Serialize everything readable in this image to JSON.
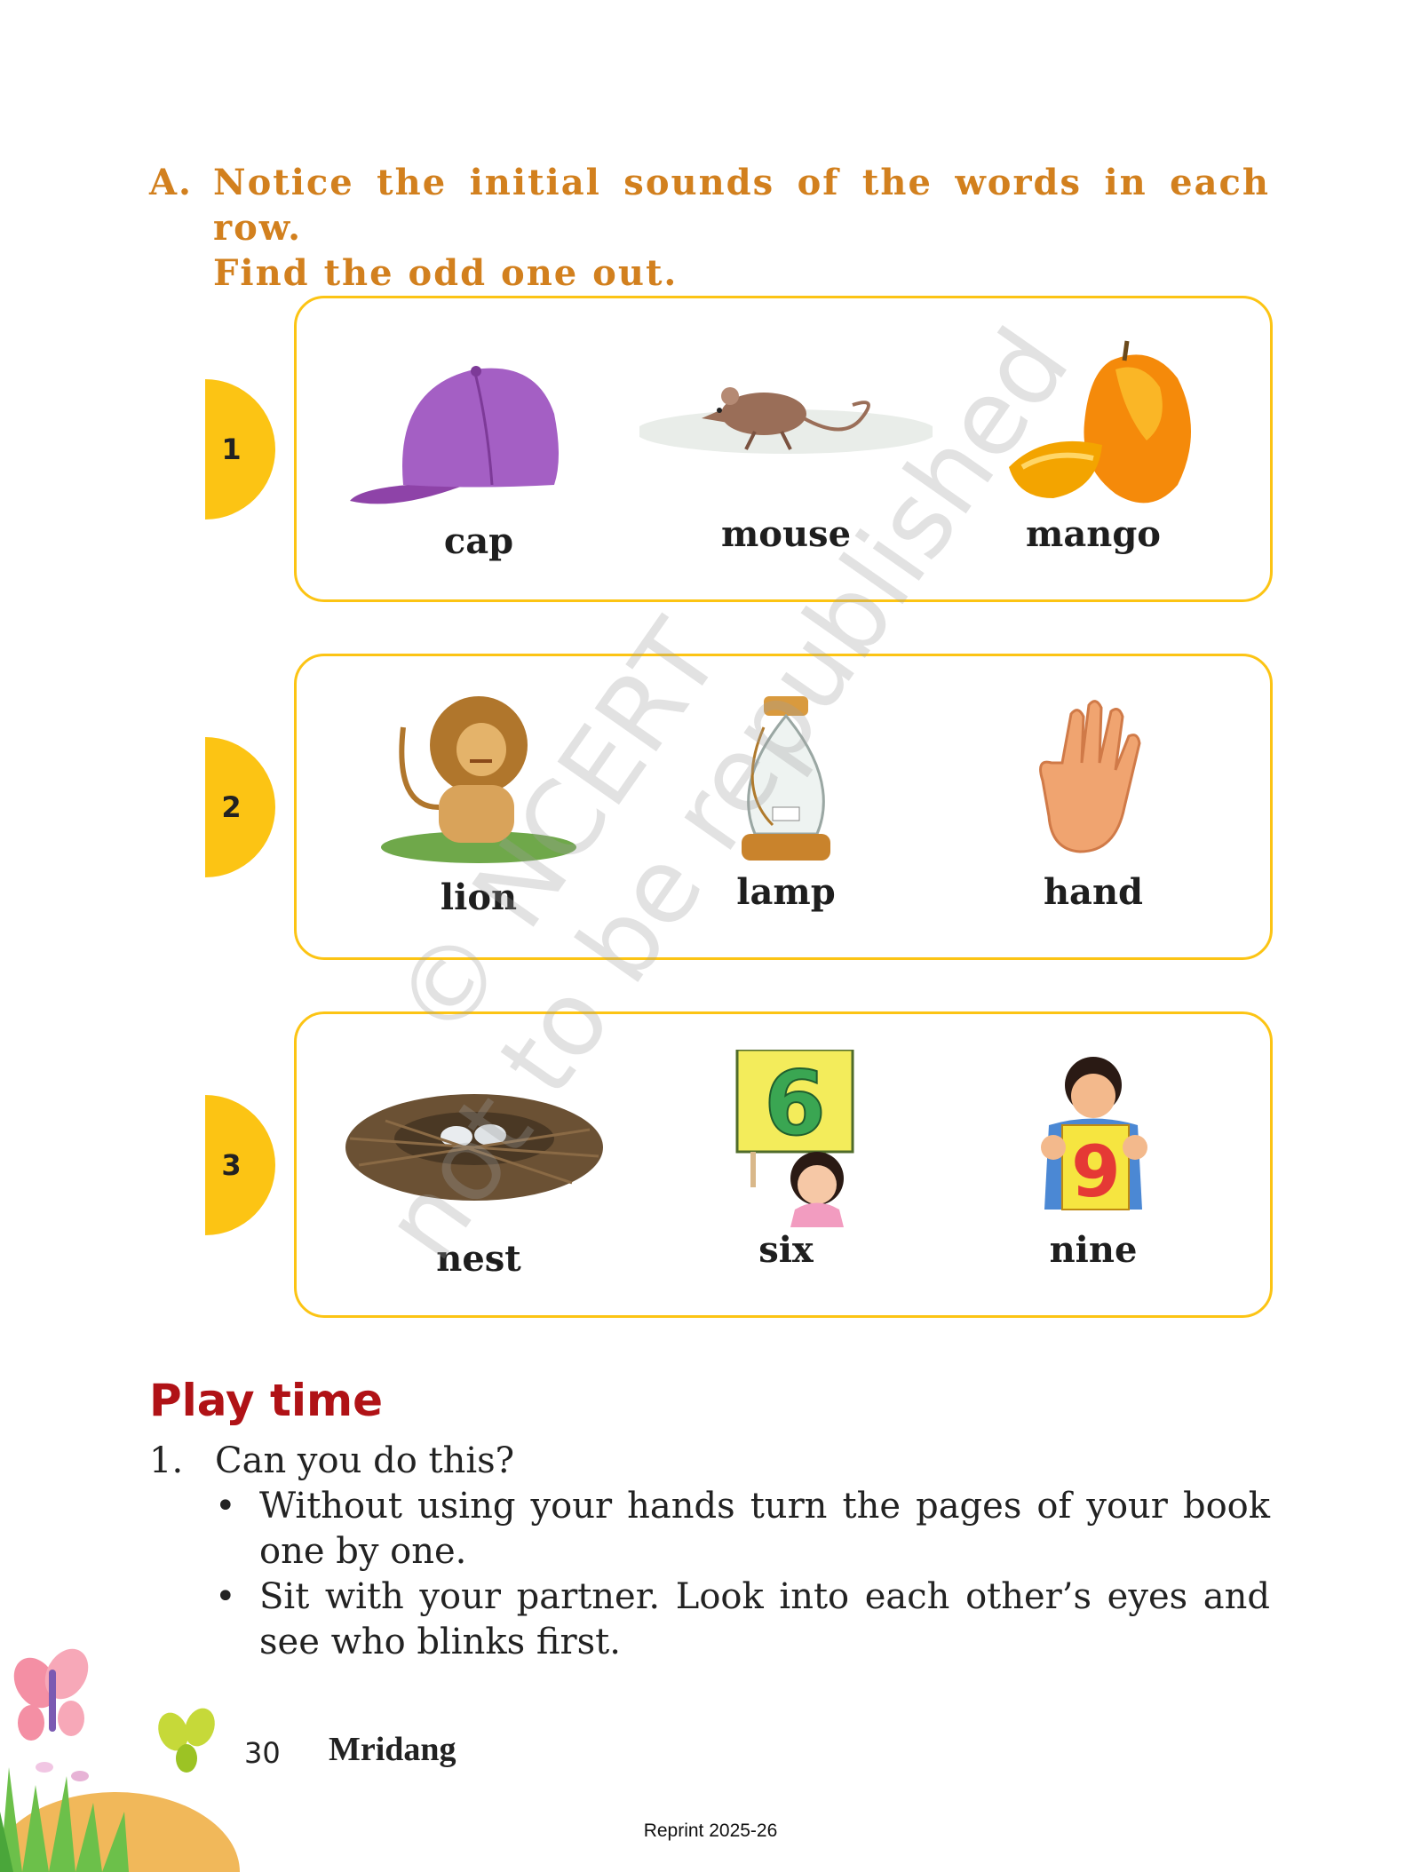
{
  "exercise": {
    "label": "A.",
    "line1": "Notice the initial sounds of the words in each row.",
    "line2": "Find the odd one out."
  },
  "rows": [
    {
      "number": "1",
      "words": [
        {
          "word": "cap",
          "picture": "purple-cap-icon"
        },
        {
          "word": "mouse",
          "picture": "mouse-icon"
        },
        {
          "word": "mango",
          "picture": "mango-icon"
        }
      ]
    },
    {
      "number": "2",
      "words": [
        {
          "word": "lion",
          "picture": "lion-icon"
        },
        {
          "word": "lamp",
          "picture": "lantern-icon"
        },
        {
          "word": "hand",
          "picture": "hand-icon"
        }
      ]
    },
    {
      "number": "3",
      "words": [
        {
          "word": "nest",
          "picture": "nest-icon"
        },
        {
          "word": "six",
          "picture": "girl-holding-six-icon"
        },
        {
          "word": "nine",
          "picture": "boy-holding-nine-icon"
        }
      ]
    }
  ],
  "watermark": {
    "line1": "© NCERT",
    "line2": "not to be republished"
  },
  "play_time": {
    "title": "Play time",
    "items": [
      {
        "number": "1.",
        "text": "Can you do this?",
        "bullets": [
          "Without using your hands turn the pages of your book one by one.",
          "Sit with your partner. Look into each other’s eyes and see who blinks first."
        ]
      }
    ]
  },
  "footer": {
    "page_number": "30",
    "book_title": "Mridang",
    "reprint": "Reprint 2025-26"
  },
  "colors": {
    "heading": "#d2801e",
    "accent_yellow": "#fcc414",
    "play_title": "#b01216"
  }
}
